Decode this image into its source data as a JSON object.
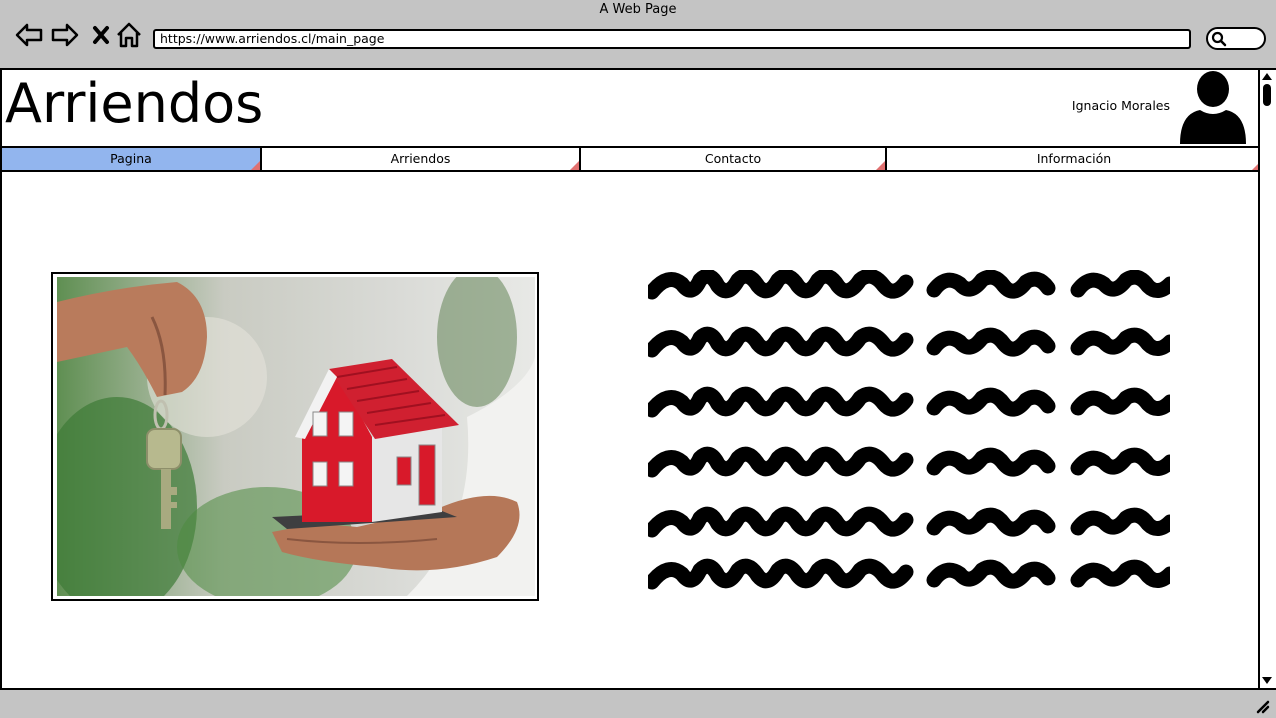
{
  "browser": {
    "window_title": "A Web Page",
    "url": "https://www.arriendos.cl/main_page",
    "nav_icons": [
      "back-arrow-icon",
      "forward-arrow-icon",
      "close-x-icon",
      "home-icon"
    ],
    "search_icon": "search-icon"
  },
  "header": {
    "site_title": "Arriendos",
    "user_name": "Ignacio Morales",
    "avatar_icon": "user-avatar-icon"
  },
  "tabs": [
    {
      "label": "Pagina",
      "active": true
    },
    {
      "label": "Arriendos",
      "active": false
    },
    {
      "label": "Contacto",
      "active": false
    },
    {
      "label": "Información",
      "active": false
    }
  ],
  "main": {
    "image_subject": "hand holding keys and a small red-roofed house model",
    "text_placeholder_lines": 6
  },
  "colors": {
    "chrome_gray": "#c4c4c4",
    "active_tab": "#92b5ee",
    "tab_corner_marker": "#e07070",
    "house_roof_red": "#d8192a"
  }
}
